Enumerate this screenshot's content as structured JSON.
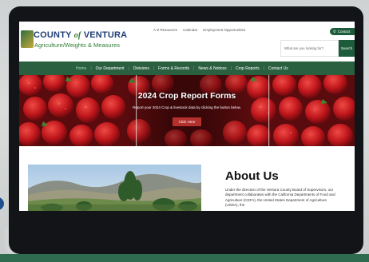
{
  "header": {
    "logo_title_a": "COUNTY",
    "logo_title_of": "of",
    "logo_title_b": "VENTURA",
    "logo_subtitle": "Agriculture/Weights & Measures",
    "top_links": [
      "A-Z Resources",
      "Calendar",
      "Employment Opportunities"
    ],
    "contact_label": "Contact",
    "search_placeholder": "What are you looking for?",
    "search_button": "Search"
  },
  "nav": {
    "items": [
      "Home",
      "Our Department",
      "Divisions",
      "Forms & Records",
      "News & Notices",
      "Crop Reports",
      "Contact Us"
    ],
    "active": "Home"
  },
  "hero": {
    "title": "2024 Crop Report Forms",
    "subtitle": "Report your 2024 Crop & livestock data by clicking the button below.",
    "button": "Click Here"
  },
  "about": {
    "title": "About Us",
    "text": "Under the direction of the Ventura County Board of Supervisors, our department collaborates with the California Departments of Food and Agriculture (CDFA), the United States Department of Agriculture (USDA), the"
  },
  "colors": {
    "brand_green": "#2a5f3f",
    "brand_blue": "#1f3f77",
    "hero_button": "#b3302d"
  }
}
